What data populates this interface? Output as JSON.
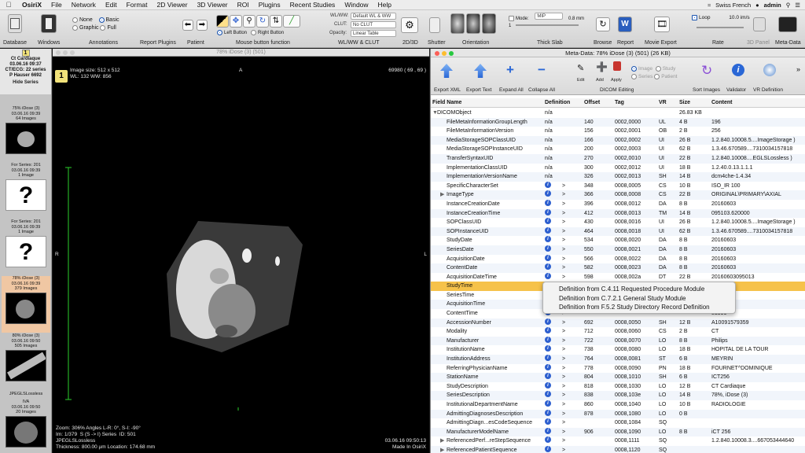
{
  "menubar": {
    "app": "OsiriX",
    "items": [
      "File",
      "Network",
      "Edit",
      "Format",
      "2D Viewer",
      "3D Viewer",
      "ROI",
      "Plugins",
      "Recent Studies",
      "Window",
      "Help"
    ],
    "input_source": "Swiss French",
    "user": "admin"
  },
  "toolbar": {
    "sections": [
      "Database",
      "Windows",
      "Annotations",
      "Report Plugins",
      "Patient",
      "Mouse button function",
      "WL/WW & CLUT",
      "2D/3D",
      "Shutter",
      "Orientation",
      "Thick Slab",
      "Browse",
      "Report",
      "Movie Export",
      "Rate",
      "3D Panel",
      "Meta-Data"
    ],
    "annotations_opts": [
      "None",
      "Basic",
      "Graphic",
      "Full"
    ],
    "left_button": "Left Button",
    "right_button": "Right Button",
    "wlww_label": "WL/WW:",
    "wlww_value": "Default WL & WW",
    "clut_label": "CLUT:",
    "clut_value": "No CLUT",
    "opacity_label": "Opacity:",
    "opacity_value": "Linear Table",
    "mode_label": "Mode:",
    "mode_value": "MIP",
    "slab_mm": "0.8 mm",
    "slab_count": "1",
    "loop_label": "Loop",
    "rate": "10.0 im/s"
  },
  "patient": {
    "number": "1",
    "name": "Ct Cardiaque",
    "date": "03.06.16 09:37",
    "series_count": "CT/ECG: 22 series",
    "physician": "P Hauser 6692",
    "hide_series": "Hide Series"
  },
  "series": [
    {
      "title": "75% iDose (3)",
      "date": "03.06.16 09:39",
      "count": "64 Images"
    },
    {
      "title": "For Series: 201",
      "date": "03.06.16 09:39",
      "count": "1 Image"
    },
    {
      "title": "For Series: 201",
      "date": "03.06.16 09:39",
      "count": "1 Image"
    },
    {
      "title": "78% iDose (3)",
      "date": "03.06.16 09:39",
      "count": "379 Images"
    },
    {
      "title": "80% iDose (3)",
      "date": "03.06.16 09:50",
      "count": "505 Images"
    },
    {
      "title": "JPEGLSLossless",
      "date": "03.06.16 09:50",
      "count": "JPEGLSLossless"
    },
    {
      "title": "IVA",
      "date": "03.06.16 09:50",
      "count": "20 Images"
    }
  ],
  "viewer": {
    "title": "78% iDose (3) (501)",
    "image_num": "1",
    "top_left": "Image size: 512 x 512\nWL: 132 WW: 856",
    "top_right": "69980 ( 69 , 69 )",
    "orient_top": "A",
    "orient_left": "R",
    "orient_right": "L",
    "bottom_left": "Zoom: 306% Angles L-R: 0°, S-I: -90°\nIm: 1/379  S (S -> I) Series  ID: 501\nJPEGLSLossless\nThickness: 800.00 µm Location: 174.68 mm",
    "bottom_right": "03.06.16 09:50:13\nMade In OsiriX"
  },
  "metadata": {
    "title": "Meta-Data: 78% iDose (3) (501) (26 KB)",
    "tools": [
      "Export XML",
      "Export Text",
      "Expand All",
      "Collapse All",
      "DICOM Editing",
      "Sort Images",
      "Validator",
      "VR Definition"
    ],
    "edit_tools": [
      "Edit",
      "Add",
      "Apply"
    ],
    "view_opts": [
      "Image",
      "Study",
      "Series",
      "Patient"
    ],
    "columns": [
      "Field Name",
      "Definition",
      "Offset",
      "Tag",
      "VR",
      "Size",
      "Content"
    ],
    "rows": [
      [
        "DICOMObject",
        "n/a",
        "",
        "",
        "",
        "26.83 KB",
        ""
      ],
      [
        "FileMetaInformationGroupLength",
        "n/a",
        "140",
        "0002,0000",
        "UL",
        "4 B",
        "196"
      ],
      [
        "FileMetaInformationVersion",
        "n/a",
        "156",
        "0002,0001",
        "OB",
        "2 B",
        "256"
      ],
      [
        "MediaStorageSOPClassUID",
        "n/a",
        "166",
        "0002,0002",
        "UI",
        "26 B",
        "1.2.840.10008.5....ImageStorage )"
      ],
      [
        "MediaStorageSOPInstanceUID",
        "n/a",
        "200",
        "0002,0003",
        "UI",
        "62 B",
        "1.3.46.670589....7310034157818"
      ],
      [
        "TransferSyntaxUID",
        "n/a",
        "270",
        "0002,0010",
        "UI",
        "22 B",
        "1.2.840.10008....EGLSLossless )"
      ],
      [
        "ImplementationClassUID",
        "n/a",
        "300",
        "0002,0012",
        "UI",
        "18 B",
        "1.2.40.0.13.1.1.1"
      ],
      [
        "ImplementationVersionName",
        "n/a",
        "326",
        "0002,0013",
        "SH",
        "14 B",
        "dcm4che-1.4.34"
      ],
      [
        "SpecificCharacterSet",
        "i",
        "348",
        "0008,0005",
        "CS",
        "10 B",
        "ISO_IR 100"
      ],
      [
        "ImageType",
        "i",
        "366",
        "0008,0008",
        "CS",
        "22 B",
        "ORIGINAL\\PRIMARY\\AXIAL"
      ],
      [
        "InstanceCreationDate",
        "i",
        "396",
        "0008,0012",
        "DA",
        "8 B",
        "20160603"
      ],
      [
        "InstanceCreationTime",
        "i",
        "412",
        "0008,0013",
        "TM",
        "14 B",
        "095103.620000"
      ],
      [
        "SOPClassUID",
        "i",
        "430",
        "0008,0016",
        "UI",
        "26 B",
        "1.2.840.10008.5....ImageStorage )"
      ],
      [
        "SOPInstanceUID",
        "i",
        "464",
        "0008,0018",
        "UI",
        "62 B",
        "1.3.46.670589....7310034157818"
      ],
      [
        "StudyDate",
        "i",
        "534",
        "0008,0020",
        "DA",
        "8 B",
        "20160603"
      ],
      [
        "SeriesDate",
        "i",
        "550",
        "0008,0021",
        "DA",
        "8 B",
        "20160603"
      ],
      [
        "AcquisitionDate",
        "i",
        "566",
        "0008,0022",
        "DA",
        "8 B",
        "20160603"
      ],
      [
        "ContentDate",
        "i",
        "582",
        "0008,0023",
        "DA",
        "8 B",
        "20160603"
      ],
      [
        "AcquisitionDateTime",
        "i",
        "598",
        "0008,002a",
        "DT",
        "22 B",
        "20160603095013"
      ],
      [
        "StudyTime",
        "i",
        "",
        "",
        "",
        "",
        ""
      ],
      [
        "SeriesTime",
        "i",
        "",
        "",
        "",
        "",
        "19000"
      ],
      [
        "AcquisitionTime",
        "i",
        "",
        "",
        "",
        "",
        "00000"
      ],
      [
        "ContentTime",
        "i",
        "",
        "",
        "",
        "",
        "81999"
      ],
      [
        "AccessionNumber",
        "i",
        "692",
        "0008,0050",
        "SH",
        "12 B",
        "A10091579359"
      ],
      [
        "Modality",
        "i",
        "712",
        "0008,0060",
        "CS",
        "2 B",
        "CT"
      ],
      [
        "Manufacturer",
        "i",
        "722",
        "0008,0070",
        "LO",
        "8 B",
        "Philips"
      ],
      [
        "InstitutionName",
        "i",
        "738",
        "0008,0080",
        "LO",
        "18 B",
        "HOPITAL DE LA TOUR"
      ],
      [
        "InstitutionAddress",
        "i",
        "764",
        "0008,0081",
        "ST",
        "6 B",
        "MEYRIN"
      ],
      [
        "ReferringPhysicianName",
        "i",
        "778",
        "0008,0090",
        "PN",
        "18 B",
        "FOURNET^DOMINIQUE"
      ],
      [
        "StationName",
        "i",
        "804",
        "0008,1010",
        "SH",
        "6 B",
        "ICT256"
      ],
      [
        "StudyDescription",
        "i",
        "818",
        "0008,1030",
        "LO",
        "12 B",
        "CT Cardiaque"
      ],
      [
        "SeriesDescription",
        "i",
        "838",
        "0008,103e",
        "LO",
        "14 B",
        "78%, iDose (3)"
      ],
      [
        "InstitutionalDepartmentName",
        "i",
        "860",
        "0008,1040",
        "LO",
        "10 B",
        "RADIOLOGIE"
      ],
      [
        "AdmittingDiagnosesDescription",
        "i",
        "878",
        "0008,1080",
        "LO",
        "0 B",
        ""
      ],
      [
        "AdmittingDiagn...esCodeSequence",
        "i",
        "",
        "0008,1084",
        "SQ",
        "",
        ""
      ],
      [
        "ManufacturerModelName",
        "i",
        "906",
        "0008,1090",
        "LO",
        "8 B",
        "iCT 256"
      ],
      [
        "ReferencedPerf...reStepSequence",
        "i",
        "",
        "0008,1111",
        "SQ",
        "",
        "1.2.840.10008.3....667053444640"
      ],
      [
        "ReferencedPatientSequence",
        "i",
        "",
        "0008,1120",
        "SQ",
        "",
        ""
      ]
    ],
    "highlight_row": 19,
    "popup": [
      "Definition from C.4.11 Requested Procedure Module",
      "Definition from C.7.2.1 General Study Module",
      "Definition from F.5.2 Study Directory Record Definition"
    ]
  }
}
